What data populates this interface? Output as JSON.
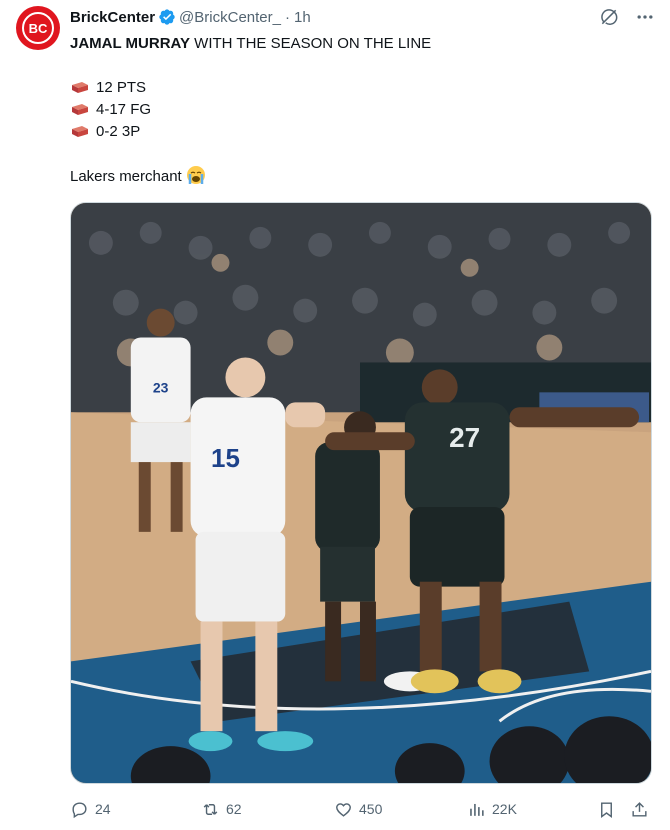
{
  "tweet": {
    "author_name": "BrickCenter",
    "author_handle": "@BrickCenter_",
    "separator": "·",
    "time": "1h",
    "avatar_text": "BC",
    "headline_bold": "JAMAL MURRAY",
    "headline_rest": " WITH THE SEASON ON THE LINE",
    "stats": [
      "12 PTS",
      "4-17 FG",
      "0-2 3P"
    ],
    "caption": "Lakers merchant",
    "media_alt": "Basketball game still: Nuggets players in white jerseys #15 and #23, Timberwolves player in dark jersey #27"
  },
  "media": {
    "jersey_numbers": [
      "15",
      "27",
      "23"
    ]
  },
  "actions": {
    "replies": "24",
    "reposts": "62",
    "likes": "450",
    "views": "22K"
  },
  "icons": {
    "verified": "verified-badge-icon",
    "grok": "grok-icon",
    "more": "more-icon",
    "reply": "reply-icon",
    "repost": "repost-icon",
    "like": "like-icon",
    "views": "views-icon",
    "bookmark": "bookmark-icon",
    "share": "share-icon"
  },
  "colors": {
    "brand_red": "#e0161f",
    "verified_blue": "#1d9bf0",
    "muted_text": "#536471"
  }
}
